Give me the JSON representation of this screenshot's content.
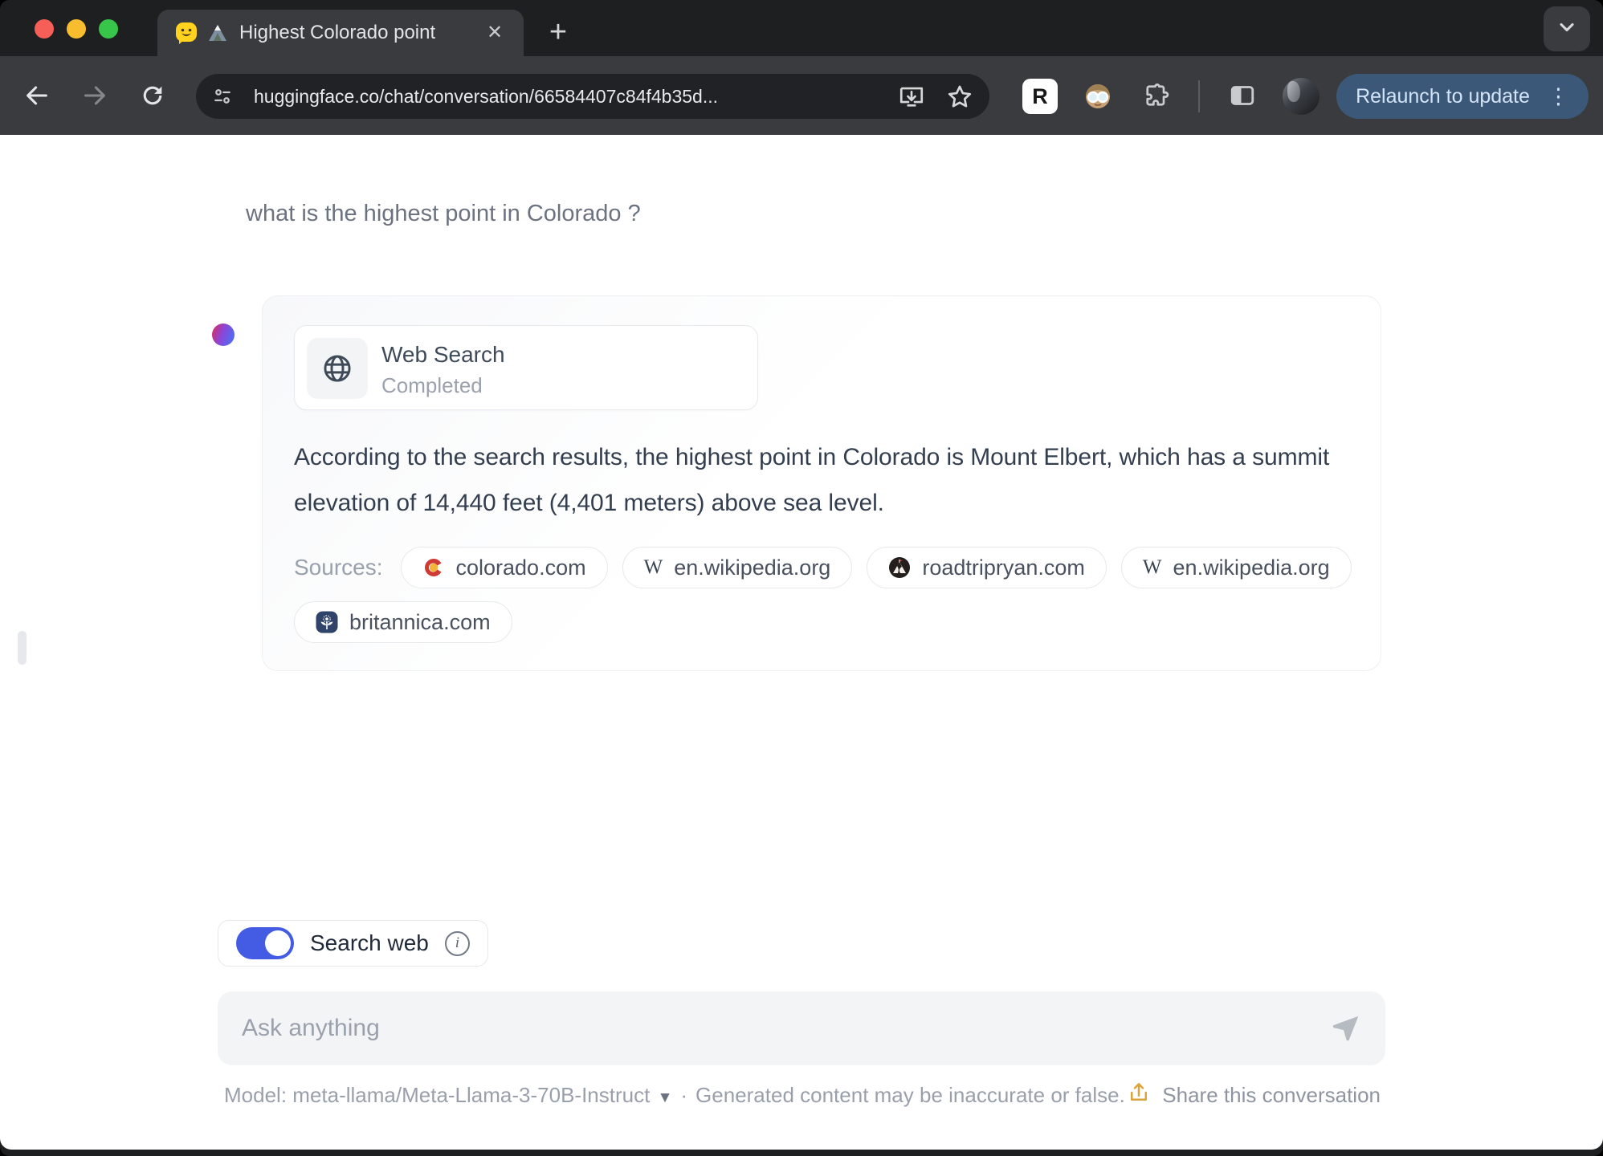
{
  "window": {
    "tab": {
      "title": "Highest Colorado point"
    },
    "tab_controls": {
      "close_glyph": "✕",
      "new_tab_glyph": "+"
    },
    "toolbar": {
      "url": "huggingface.co/chat/conversation/66584407c84f4b35d...",
      "relaunch_label": "Relaunch to update",
      "more_glyph": "⋮",
      "r_extension_glyph": "R"
    }
  },
  "chat": {
    "user_message": "what is the highest point in Colorado ?",
    "tool_card": {
      "title": "Web Search",
      "status": "Completed"
    },
    "response": "According to the search results, the highest point in Colorado is Mount Elbert, which has a summit elevation of 14,440 feet (4,401 meters) above sea level.",
    "sources_label": "Sources:",
    "sources": [
      {
        "domain": "colorado.com"
      },
      {
        "domain": "en.wikipedia.org"
      },
      {
        "domain": "roadtripryan.com"
      },
      {
        "domain": "en.wikipedia.org"
      },
      {
        "domain": "britannica.com"
      }
    ],
    "wikipedia_glyph": "W",
    "toggle": {
      "label": "Search web",
      "state": "on",
      "info_glyph": "i"
    },
    "input": {
      "placeholder": "Ask anything",
      "value": ""
    },
    "footer": {
      "model_label": "Model:",
      "model_name": "meta-llama/Meta-Llama-3-70B-Instruct",
      "caret_glyph": "▼",
      "dot_separator": "·",
      "disclaimer": "Generated content may be inaccurate or false.",
      "share_label": "Share this conversation"
    }
  },
  "colors": {
    "accent_toggle": "#445ce4",
    "relaunch_bg": "#3c5878",
    "avatar_gradient": [
      "#d62e63",
      "#8b46d8",
      "#4e6ef2"
    ],
    "share_icon": "#dba339",
    "traffic_lights": [
      "#f55f57",
      "#f8bd2e",
      "#37c649"
    ]
  }
}
